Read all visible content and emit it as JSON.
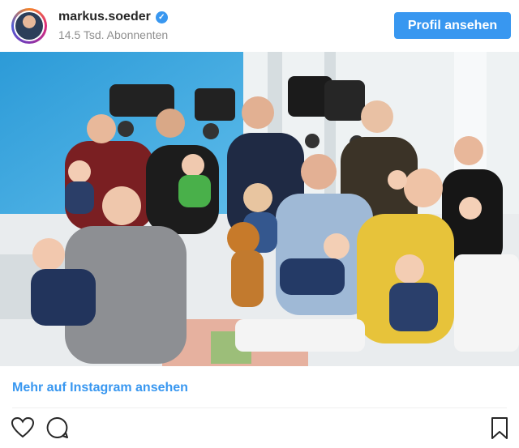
{
  "header": {
    "username": "markus.soeder",
    "followers": "14.5 Tsd. Abonnenten",
    "profile_button": "Profil ansehen"
  },
  "post": {
    "image_alt": "Gruppenfoto mit Familien und Babys",
    "more_link": "Mehr auf Instagram ansehen"
  },
  "colors": {
    "accent": "#3897f0",
    "text": "#262626",
    "muted": "#8e8e8e"
  },
  "icons": [
    "verified-badge-icon",
    "heart-icon",
    "comment-icon",
    "bookmark-icon"
  ]
}
